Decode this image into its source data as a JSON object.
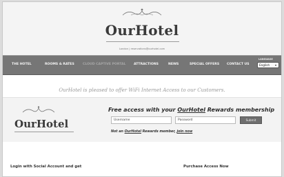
{
  "header": {
    "brand": "OurHotel",
    "contact_label": "London",
    "contact_email": "reservations@ourhotel.com"
  },
  "nav": {
    "items": [
      {
        "label": "THE HOTEL",
        "active": false
      },
      {
        "label": "ROOMS & RATES",
        "active": false
      },
      {
        "label": "CLOUD CAPTIVE PORTAL",
        "active": true
      },
      {
        "label": "ATTRACTIONS",
        "active": false
      },
      {
        "label": "NEWS",
        "active": false
      },
      {
        "label": "SPECIAL OFFERS",
        "active": false
      },
      {
        "label": "CONTACT US",
        "active": false
      }
    ],
    "language_label": "LANGUAGE",
    "language_value": "English"
  },
  "welcome": {
    "brand": "OurHotel",
    "text": " is pleased to offer WiFi Internet Access to our Customers."
  },
  "membership": {
    "logo": "OurHotel",
    "title_prefix": "Free access with your ",
    "title_brand": "OurHotel",
    "title_suffix": " Rewards membership",
    "username_placeholder": "Username",
    "password_placeholder": "Password",
    "submit_label": "Submit",
    "not_member_prefix": "Not an ",
    "not_member_brand": "OurHotel",
    "not_member_middle": " Rewards member, ",
    "join_link": "join now"
  },
  "sections": {
    "social_login": "Login with Social Account and get",
    "purchase": "Purchase Access Now"
  }
}
